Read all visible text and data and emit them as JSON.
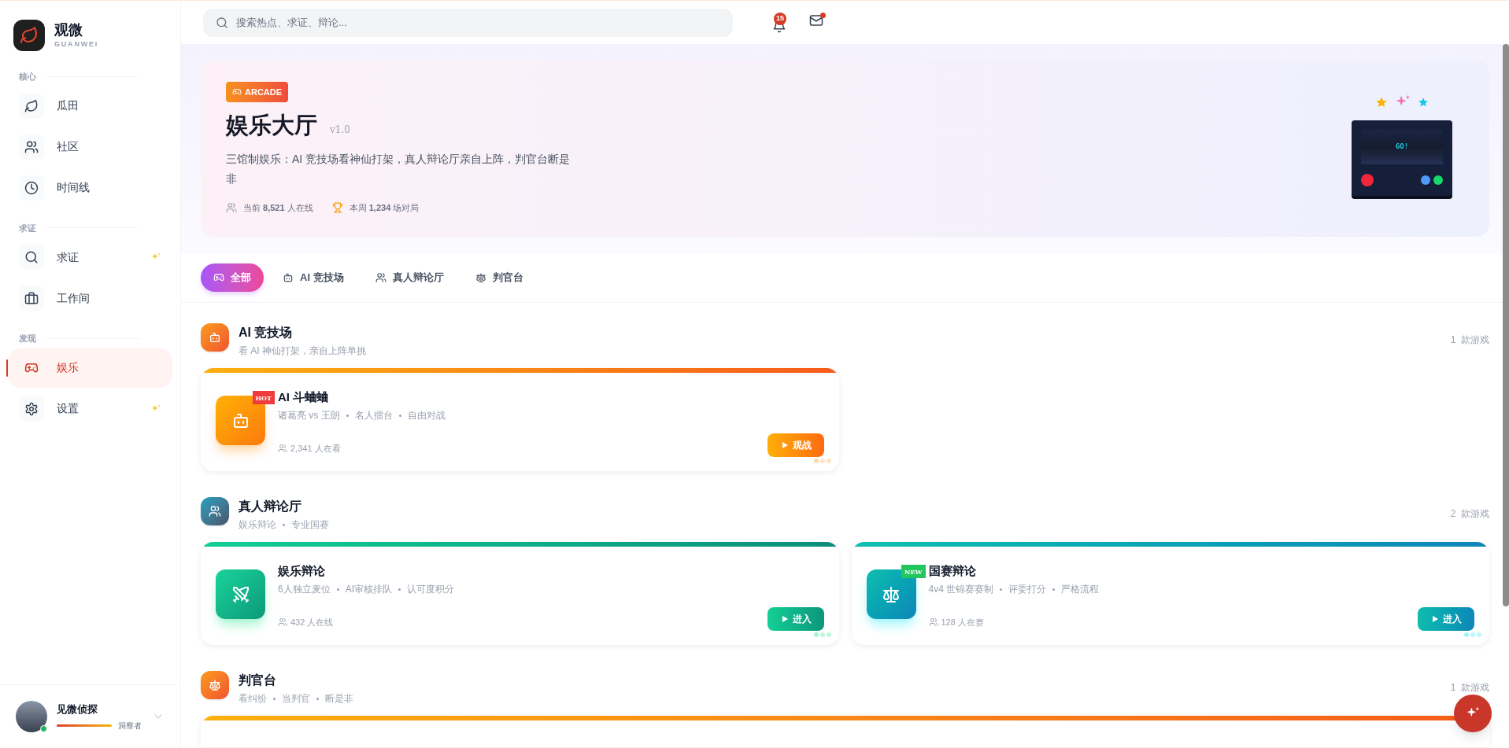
{
  "brand": {
    "name": "观微",
    "subtitle": "GUANWEI"
  },
  "nav_groups": [
    {
      "label": "核心",
      "items": [
        {
          "label": "瓜田",
          "selected": false,
          "sparkle": false
        },
        {
          "label": "社区",
          "selected": false,
          "sparkle": false
        },
        {
          "label": "时间线",
          "selected": false,
          "sparkle": false
        }
      ]
    },
    {
      "label": "求证",
      "items": [
        {
          "label": "求证",
          "selected": false,
          "sparkle": true
        },
        {
          "label": "工作间",
          "selected": false,
          "sparkle": false
        }
      ]
    },
    {
      "label": "发现",
      "items": [
        {
          "label": "娱乐",
          "selected": true,
          "sparkle": false
        },
        {
          "label": "设置",
          "selected": false,
          "sparkle": true
        }
      ]
    }
  ],
  "user": {
    "name": "见微侦探",
    "rank": "洞察者",
    "level": 1,
    "online": true
  },
  "topbar": {
    "search": {
      "placeholder": "搜索热点、求证、辩论..."
    },
    "notifications": "15",
    "mail_unread": true
  },
  "hero": {
    "tag": "ARCADE",
    "title": "娱乐大厅",
    "version": "v1.0",
    "description": "三馆制娱乐：AI 竞技场看神仙打架，真人辩论厅亲自上阵，判官台断是非",
    "stats": [
      "当前 **8,521** 人在线",
      "本周 **1,234** 场对局"
    ],
    "screen_text": "GO!"
  },
  "tabs": [
    {
      "label": "全部",
      "selected": true
    },
    {
      "label": "AI 竞技场",
      "selected": false
    },
    {
      "label": "真人辩论厅",
      "selected": false
    },
    {
      "label": "判官台",
      "selected": false
    }
  ],
  "sections": [
    {
      "title": "AI 竞技场",
      "subtitle": [
        "看 AI 神仙打架，亲自上阵单挑"
      ],
      "count": "1  款游戏",
      "card_peek": false,
      "games": [
        {
          "title": "AI 斗蛐蛐",
          "tags": [
            "诸葛亮 vs 王朗",
            "名人擂台",
            "自由对战"
          ],
          "stat": "2,341 人在看",
          "badge": "HOT",
          "button": "观战"
        }
      ]
    },
    {
      "title": "真人辩论厅",
      "subtitle": [
        "娱乐辩论",
        "专业国赛"
      ],
      "count": "2  款游戏",
      "card_peek": false,
      "games": [
        {
          "title": "娱乐辩论",
          "tags": [
            "6人独立麦位",
            "AI审核排队",
            "认可度积分"
          ],
          "stat": "432 人在线",
          "button": "进入"
        },
        {
          "title": "国赛辩论",
          "tags": [
            "4v4 世锦赛赛制",
            "评委打分",
            "严格流程"
          ],
          "stat": "128 人在赛",
          "badge": "NEW",
          "button": "进入"
        }
      ]
    },
    {
      "title": "判官台",
      "subtitle": [
        "看纠纷",
        "当判官",
        "断是非"
      ],
      "count": "1  款游戏",
      "card_peek": true
    }
  ]
}
